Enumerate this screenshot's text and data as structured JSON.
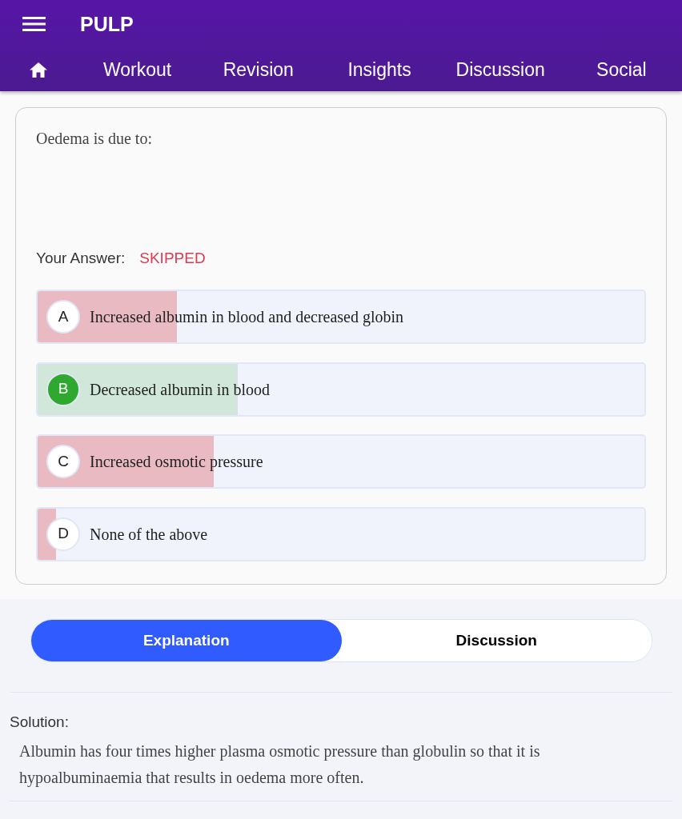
{
  "app_bar": {
    "title": "PULP"
  },
  "nav_tabs": [
    "Workout",
    "Revision",
    "Insights",
    "Discussion",
    "Social"
  ],
  "question": {
    "text": "Oedema is due to:",
    "answer_label": "Your Answer:",
    "answer_value": "SKIPPED"
  },
  "options": [
    {
      "letter": "A",
      "text": "Increased albumin in blood and decreased globin",
      "level": 0.23,
      "correct": false
    },
    {
      "letter": "B",
      "text": "Decreased albumin in blood",
      "level": 0.33,
      "correct": true
    },
    {
      "letter": "C",
      "text": "Increased osmotic pressure",
      "level": 0.29,
      "correct": false
    },
    {
      "letter": "D",
      "text": "None of the above",
      "level": 0.03,
      "correct": false
    }
  ],
  "view_tabs": [
    {
      "label": "Explanation",
      "selected": true
    },
    {
      "label": "Discussion",
      "selected": false
    }
  ],
  "solution": {
    "heading": "Solution:",
    "text": "Albumin has four times higher plasma osmotic pressure than globulin so that it is hypoalbuminaemia that results in oedema more often."
  }
}
